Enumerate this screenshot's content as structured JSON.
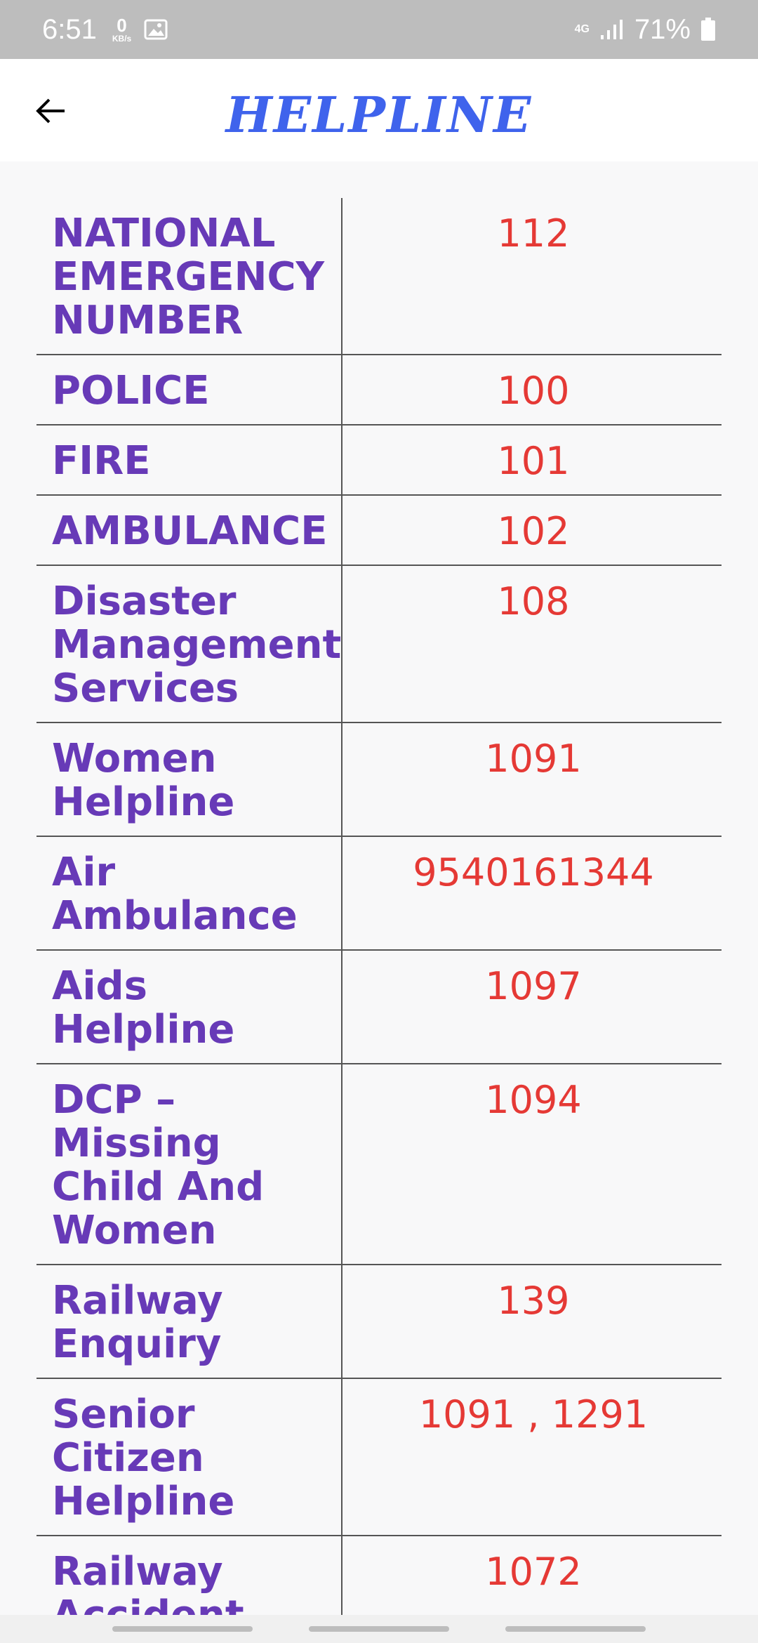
{
  "status_bar": {
    "time": "6:51",
    "kbs_value": "0",
    "kbs_unit": "KB/s",
    "network": "4G",
    "battery": "71%"
  },
  "app_bar": {
    "title": "HELPLINE",
    "back_icon": "arrow-left-icon"
  },
  "helplines": [
    {
      "name": "NATIONAL EMERGENCY NUMBER",
      "number": "112"
    },
    {
      "name": "POLICE",
      "number": "100"
    },
    {
      "name": "FIRE",
      "number": "101"
    },
    {
      "name": "AMBULANCE",
      "number": "102"
    },
    {
      "name": "Disaster Management Services",
      "number": "108"
    },
    {
      "name": "Women Helpline",
      "number": "1091"
    },
    {
      "name": "Air Ambulance",
      "number": "9540161344"
    },
    {
      "name": "Aids Helpline",
      "number": "1097"
    },
    {
      "name": "DCP – Missing Child And Women",
      "number": "1094"
    },
    {
      "name": "Railway Enquiry",
      "number": "139"
    },
    {
      "name": "Senior Citizen Helpline",
      "number": "1091 , 1291"
    },
    {
      "name": "Railway Accident Emergency",
      "number": "1072"
    }
  ],
  "colors": {
    "title": "#3f63ec",
    "name_text": "#673ab7",
    "number_text": "#e53935"
  }
}
